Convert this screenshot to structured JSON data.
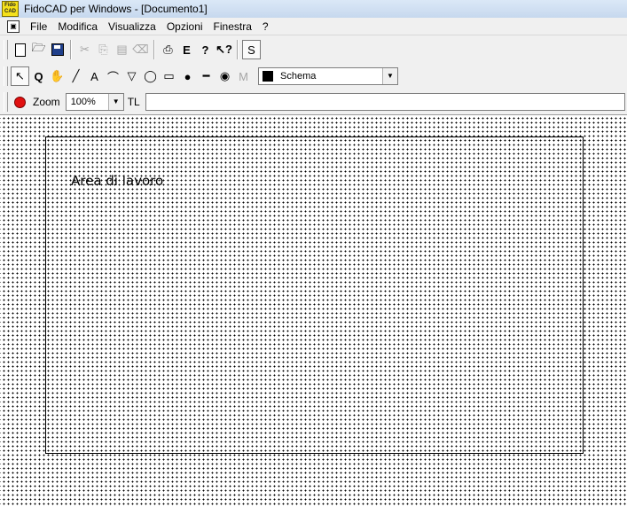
{
  "window": {
    "title": "FidoCAD per Windows - [Documento1]",
    "icon_text_top": "Fido",
    "icon_text_bottom": "CAD"
  },
  "menu": {
    "items": [
      "File",
      "Modifica",
      "Visualizza",
      "Opzioni",
      "Finestra",
      "?"
    ]
  },
  "toolbar_standard": {
    "buttons": [
      {
        "name": "new-document-icon",
        "glyph": ""
      },
      {
        "name": "open-folder-icon",
        "glyph": "📂"
      },
      {
        "name": "save-icon",
        "glyph": ""
      },
      {
        "name": "cut-icon",
        "glyph": "✂"
      },
      {
        "name": "copy-icon",
        "glyph": "⎘"
      },
      {
        "name": "paste-icon",
        "glyph": "📋"
      },
      {
        "name": "eraser-icon",
        "glyph": "⌫"
      },
      {
        "name": "print-icon",
        "glyph": "🖶"
      },
      {
        "name": "export-icon",
        "glyph": "E"
      },
      {
        "name": "help-icon",
        "glyph": "?"
      },
      {
        "name": "context-help-icon",
        "glyph": "?"
      },
      {
        "name": "snap-toggle",
        "glyph": "S"
      }
    ]
  },
  "toolbar_drawing": {
    "tools": [
      {
        "name": "select-tool-icon",
        "glyph": "↖"
      },
      {
        "name": "zoom-tool-icon",
        "glyph": "🔍"
      },
      {
        "name": "pan-hand-icon",
        "glyph": "✋"
      },
      {
        "name": "line-tool-icon",
        "glyph": "╱"
      },
      {
        "name": "text-tool-icon",
        "glyph": "A"
      },
      {
        "name": "bezier-tool-icon",
        "glyph": "⌒"
      },
      {
        "name": "polygon-tool-icon",
        "glyph": "▽"
      },
      {
        "name": "ellipse-tool-icon",
        "glyph": "◯"
      },
      {
        "name": "rectangle-tool-icon",
        "glyph": "▭"
      },
      {
        "name": "connection-dot-icon",
        "glyph": "●"
      },
      {
        "name": "pcb-line-icon",
        "glyph": "━"
      },
      {
        "name": "pcb-pad-icon",
        "glyph": "◉"
      },
      {
        "name": "macro-tool-icon",
        "glyph": "M"
      }
    ],
    "layer": {
      "name": "Schema",
      "color": "#000000"
    }
  },
  "toolbar_view": {
    "zoom_label": "Zoom",
    "zoom_value": "100%",
    "tl_label": "TL",
    "command_value": ""
  },
  "canvas": {
    "workarea_label": "Area di lavoro"
  }
}
